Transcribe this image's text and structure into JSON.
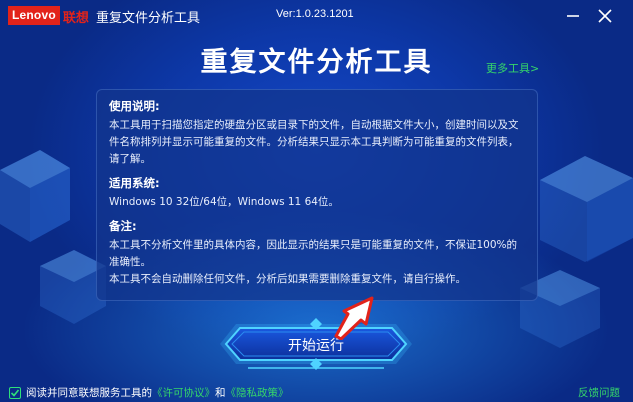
{
  "titlebar": {
    "logo_lenovo": "Lenovo",
    "logo_cn": "联想",
    "app_title": "重复文件分析工具",
    "version": "Ver:1.0.23.1201"
  },
  "header": {
    "main_title": "重复文件分析工具",
    "more_tools": "更多工具>"
  },
  "panel": {
    "usage_title": "使用说明:",
    "usage_body": "本工具用于扫描您指定的硬盘分区或目录下的文件，自动根据文件大小，创建时间以及文件名称排列并显示可能重复的文件。分析结果只显示本工具判断为可能重复的文件列表，请了解。",
    "systems_title": "适用系统:",
    "systems_body": "Windows 10 32位/64位，Windows 11 64位。",
    "notes_title": "备注:",
    "notes_body_1": "本工具不分析文件里的具体内容，因此显示的结果只是可能重复的文件，不保证100%的准确性。",
    "notes_body_2": "本工具不会自动删除任何文件，分析后如果需要删除重复文件，请自行操作。"
  },
  "start_button": "开始运行",
  "footer": {
    "agree_prefix": "阅读并同意联想服务工具的",
    "license_link": "《许可协议》",
    "and": "和",
    "privacy_link": "《隐私政策》",
    "feedback": "反馈问题"
  },
  "colors": {
    "brand_red": "#e2231a",
    "accent_green": "#35d66a",
    "background_blue": "#0d38a8"
  },
  "icons": [
    "minimize-icon",
    "close-icon",
    "check-icon",
    "arrow-pointer-icon",
    "cube-icon"
  ]
}
